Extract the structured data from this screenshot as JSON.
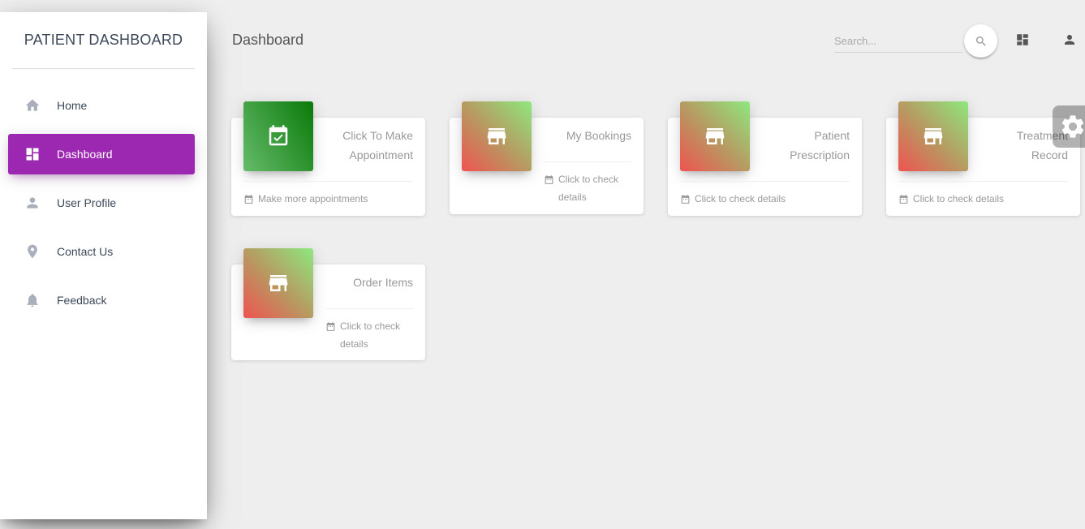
{
  "sidebar": {
    "brand": "PATIENT DASHBOARD",
    "items": [
      {
        "label": "Home",
        "icon": "home-icon",
        "active": false
      },
      {
        "label": "Dashboard",
        "icon": "dashboard-icon",
        "active": true
      },
      {
        "label": "User Profile",
        "icon": "person-icon",
        "active": false
      },
      {
        "label": "Contact Us",
        "icon": "location-pin-icon",
        "active": false
      },
      {
        "label": "Feedback",
        "icon": "bell-icon",
        "active": false
      }
    ]
  },
  "header": {
    "title": "Dashboard",
    "search_placeholder": "Search...",
    "search_icon": "search-icon",
    "dashboard_icon": "dashboard-icon",
    "user_icon": "person-icon"
  },
  "cards": [
    {
      "title_line1": "Click To Make",
      "title_line2": "Appointment",
      "footer_line1": "Make more appointments",
      "footer_line2": "",
      "icon": "calendar-check-icon",
      "gradient": "green"
    },
    {
      "title_line1": "My Bookings",
      "title_line2": "",
      "footer_line1": "Click to check",
      "footer_line2": "details",
      "icon": "store-icon",
      "gradient": "mix"
    },
    {
      "title_line1": "Patient",
      "title_line2": "Prescription",
      "footer_line1": "Click to check details",
      "footer_line2": "",
      "icon": "store-icon",
      "gradient": "mix"
    },
    {
      "title_line1": "Treatment",
      "title_line2": "Record",
      "footer_line1": "Click to check details",
      "footer_line2": "",
      "icon": "store-icon",
      "gradient": "mix"
    },
    {
      "title_line1": "Order Items",
      "title_line2": "",
      "footer_line1": "Click to check",
      "footer_line2": "details",
      "icon": "store-icon",
      "gradient": "mix"
    }
  ],
  "colors": {
    "accent": "#9c27b0",
    "background": "#eeeeee",
    "green_start": "#66bb6a",
    "green_end": "#0a7a0a",
    "mix_start": "#8ee87e",
    "mix_end": "#ef5350"
  },
  "settings_icon": "gear-icon"
}
